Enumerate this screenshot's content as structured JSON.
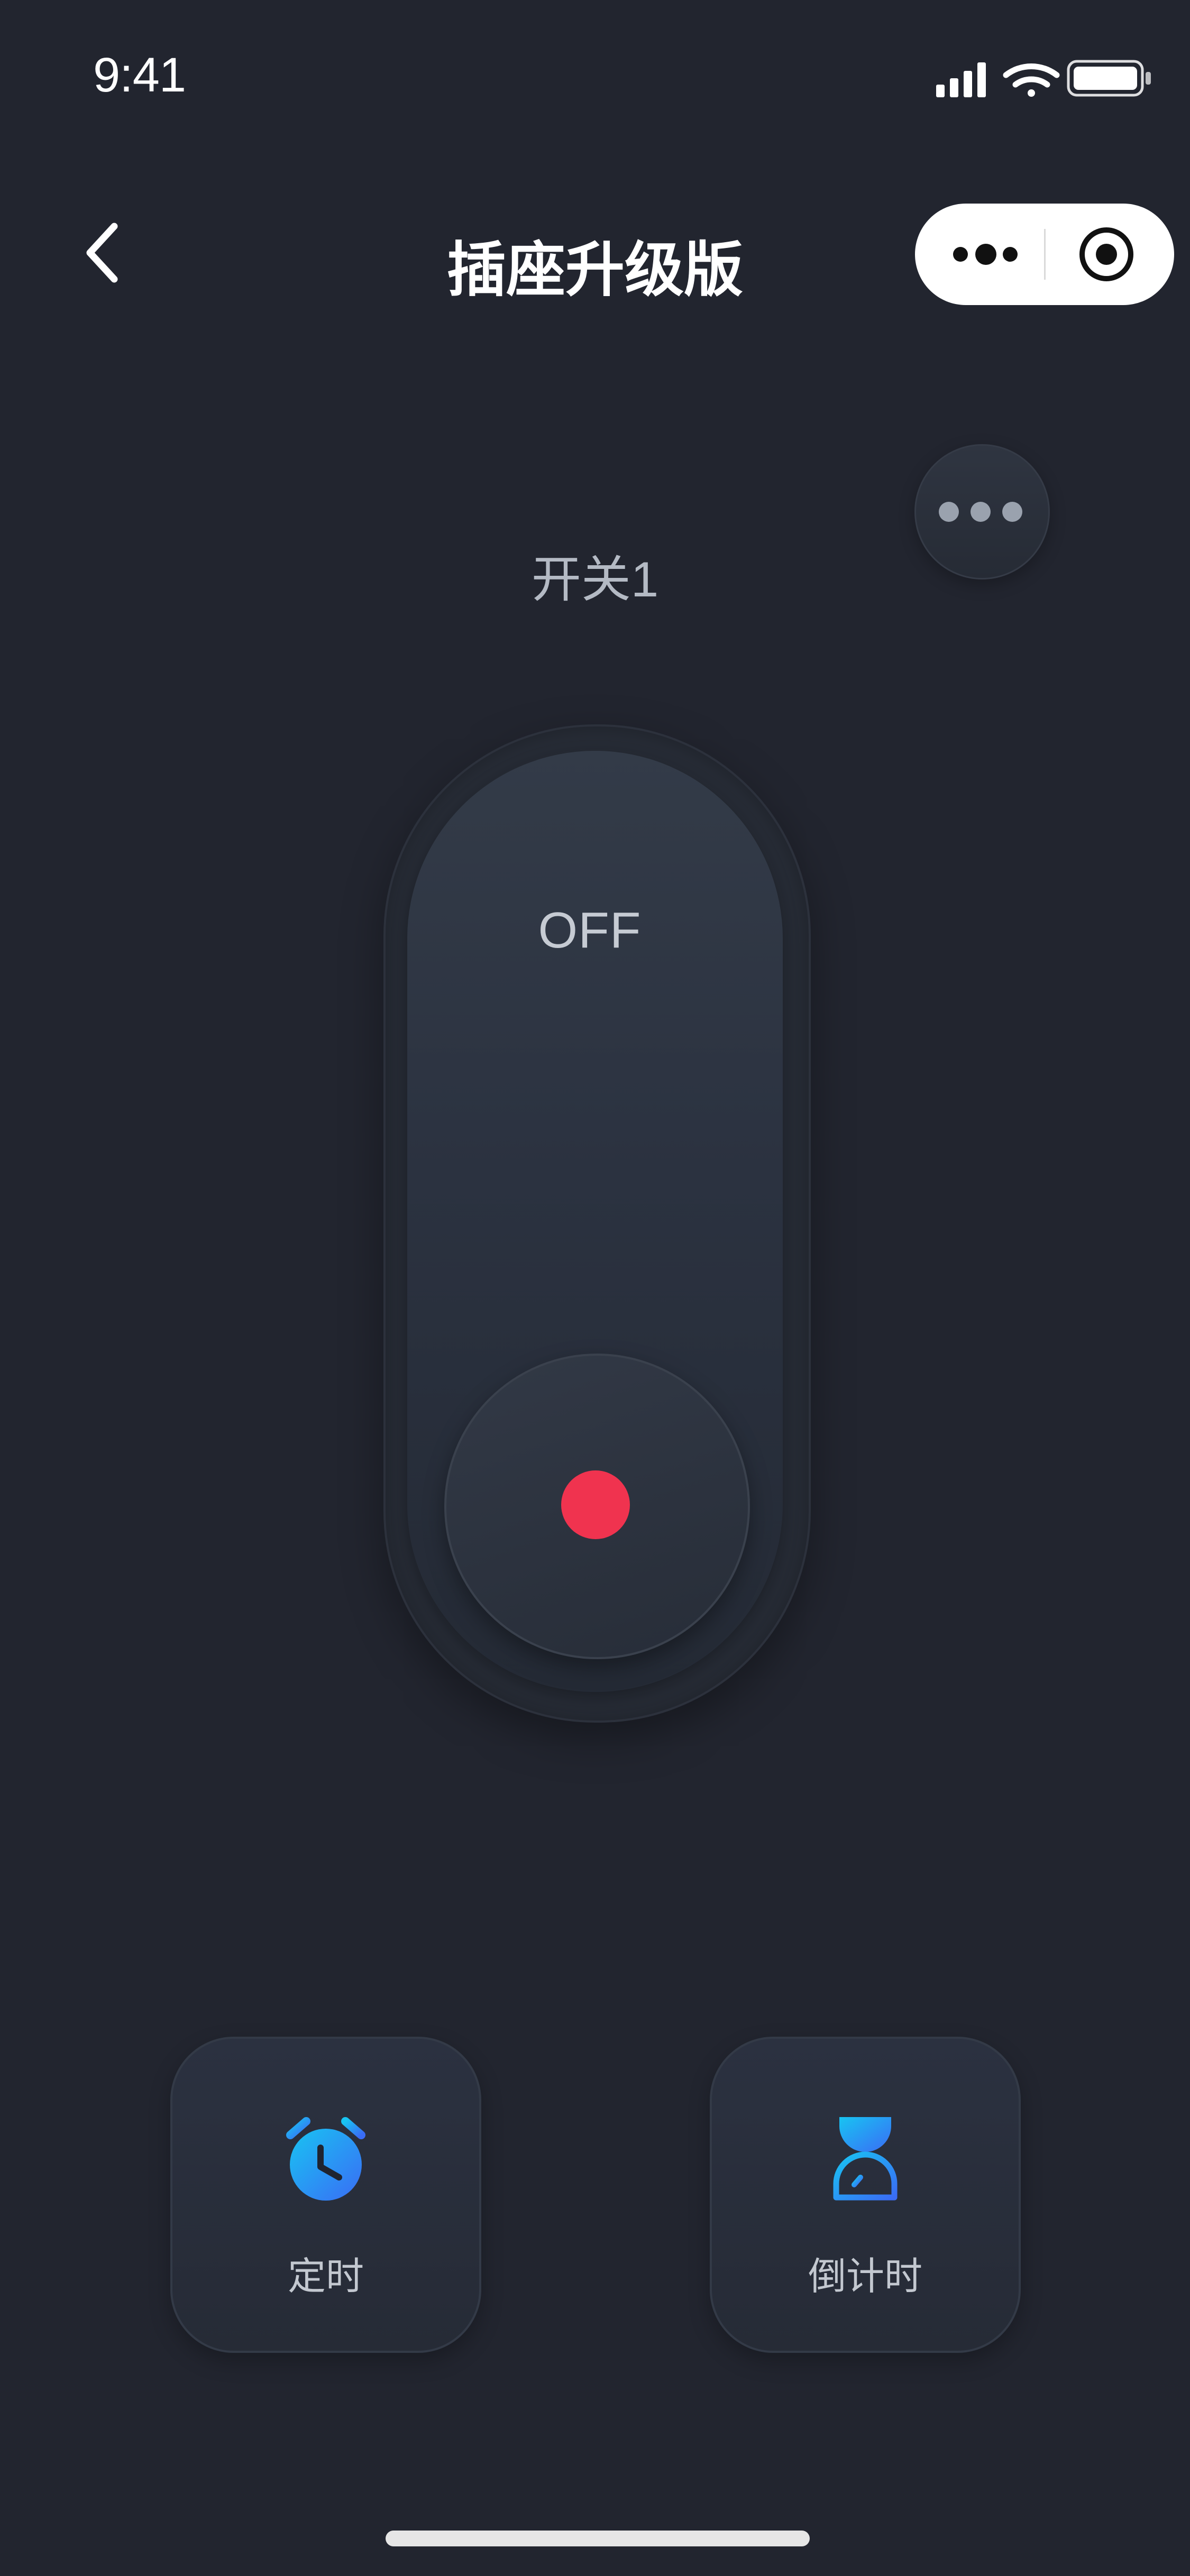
{
  "status_bar": {
    "time": "9:41",
    "icons": [
      "signal-icon",
      "wifi-icon",
      "battery-icon"
    ]
  },
  "nav": {
    "back_icon": "chevron-left-icon",
    "title": "插座升级版",
    "capsule_icons": [
      "more-dots-icon",
      "target-circle-icon"
    ]
  },
  "switch": {
    "name": "开关1",
    "state_label": "OFF",
    "indicator_color": "#f0334f"
  },
  "actions": [
    {
      "label": "定时",
      "icon": "alarm-clock-icon"
    },
    {
      "label": "倒计时",
      "icon": "hourglass-icon"
    }
  ],
  "colors": {
    "background": "#22252f",
    "accent_gradient_start": "#18c4f2",
    "accent_gradient_end": "#3a6cf5",
    "off_indicator": "#f0334f"
  }
}
